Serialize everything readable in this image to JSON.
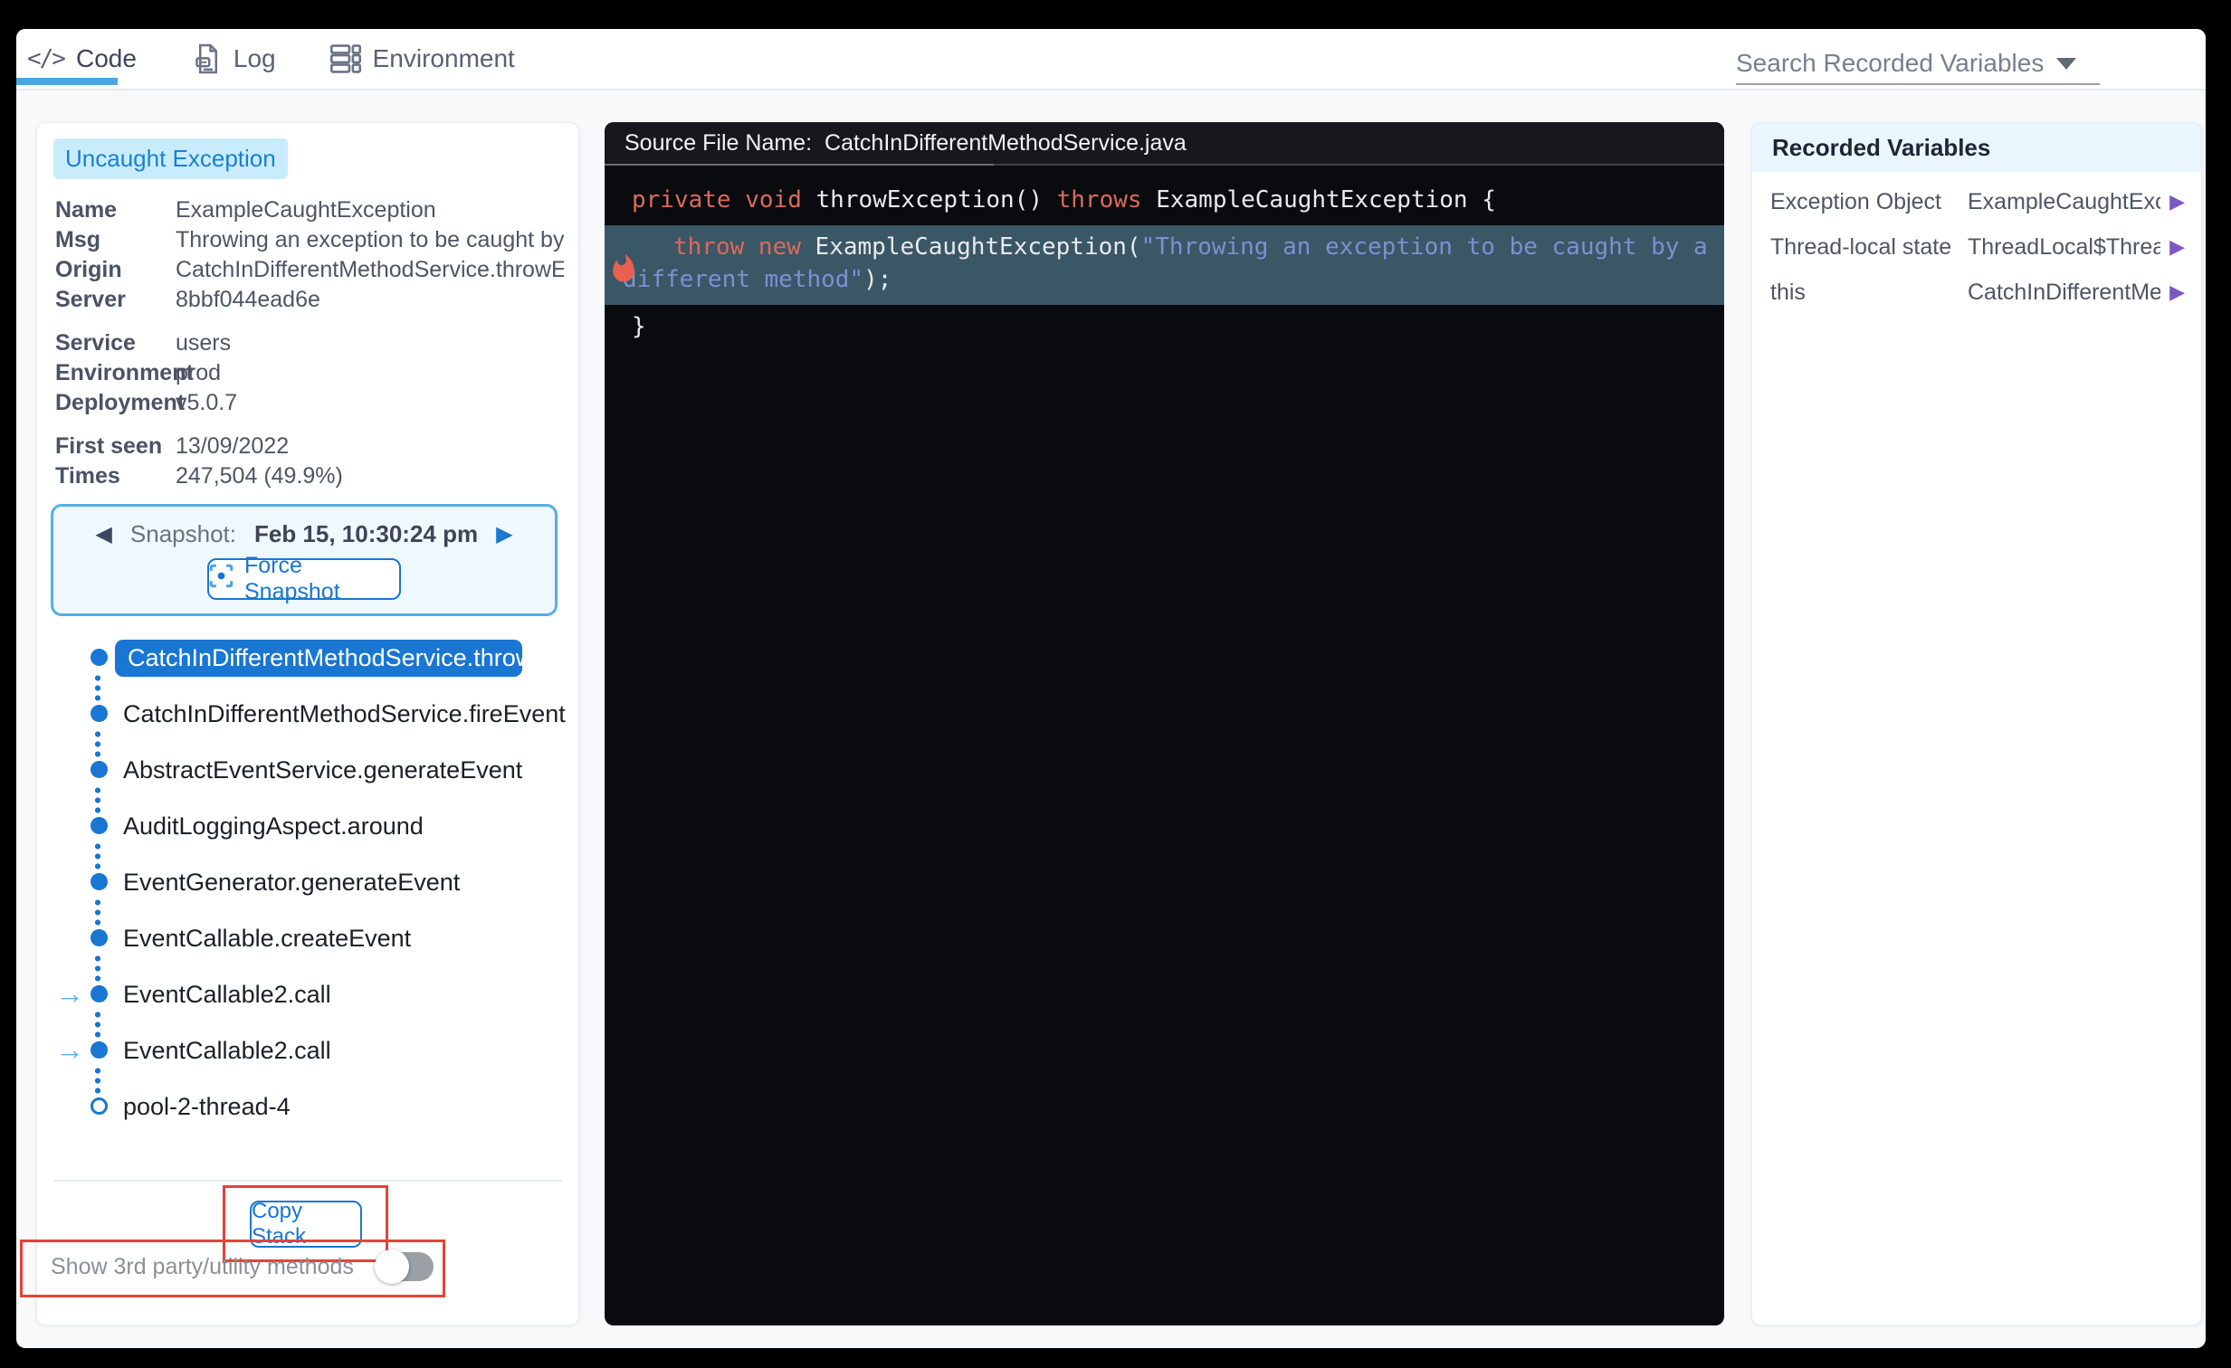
{
  "tabs": {
    "code": "Code",
    "log": "Log",
    "environment": "Environment"
  },
  "search": {
    "label": "Search Recorded Variables"
  },
  "exception_panel": {
    "badge": "Uncaught Exception",
    "group1": [
      {
        "label": "Name",
        "value": "ExampleCaughtException"
      },
      {
        "label": "Msg",
        "value": "Throwing an exception to be caught by a different method"
      },
      {
        "label": "Origin",
        "value": "CatchInDifferentMethodService.throwException"
      },
      {
        "label": "Server",
        "value": "8bbf044ead6e"
      }
    ],
    "group2": [
      {
        "label": "Service",
        "value": "users"
      },
      {
        "label": "Environment",
        "value": "prod"
      },
      {
        "label": "Deployment",
        "value": "v5.0.7"
      }
    ],
    "group3": [
      {
        "label": "First seen",
        "value": "13/09/2022"
      },
      {
        "label": "Times",
        "value": "247,504 (49.9%)"
      }
    ]
  },
  "snapshot": {
    "label": "Snapshot:",
    "datetime": "Feb 15, 10:30:24 pm",
    "force_button": "Force Snapshot"
  },
  "stack": {
    "frames": [
      {
        "label": "CatchInDifferentMethodService.throwEx..."
      },
      {
        "label": "CatchInDifferentMethodService.fireEvent"
      },
      {
        "label": "AbstractEventService.generateEvent"
      },
      {
        "label": "AuditLoggingAspect.around"
      },
      {
        "label": "EventGenerator.generateEvent"
      },
      {
        "label": "EventCallable.createEvent"
      },
      {
        "label": "EventCallable2.call"
      },
      {
        "label": "EventCallable2.call"
      },
      {
        "label": "pool-2-thread-4"
      }
    ],
    "copy_button": "Copy Stack",
    "toggle_label": "Show 3rd party/utility methods"
  },
  "code_panel": {
    "header_label": "Source File Name:",
    "file_name": "CatchInDifferentMethodService.java",
    "line1": {
      "kw1": "private ",
      "kw2": "void ",
      "t1": "throwException() ",
      "kw3": "throws ",
      "t2": "ExampleCaughtException {"
    },
    "line2": {
      "kw1": "throw ",
      "kw2": "new ",
      "t1": "ExampleCaughtException(",
      "str": "\"Throwing an exception to be caught by a different method\"",
      "t2": ");"
    },
    "line3": "}"
  },
  "recorded_variables": {
    "title": "Recorded Variables",
    "rows": [
      {
        "name": "Exception Object",
        "value": "ExampleCaughtExcept..."
      },
      {
        "name": "Thread-local state",
        "value": "ThreadLocal$ThreadL..."
      },
      {
        "name": "this",
        "value": "CatchInDifferentMetho..."
      }
    ]
  },
  "colors": {
    "accent_blue": "#1976d2",
    "tab_underline": "#4ba5e2",
    "badge_bg": "#c9ecfc",
    "highlight_row": "#3a5766",
    "keyword": "#d96a5c",
    "string": "#7d90d2",
    "annotation_red": "#e6413a",
    "arrow_purple": "#7e57c2"
  }
}
